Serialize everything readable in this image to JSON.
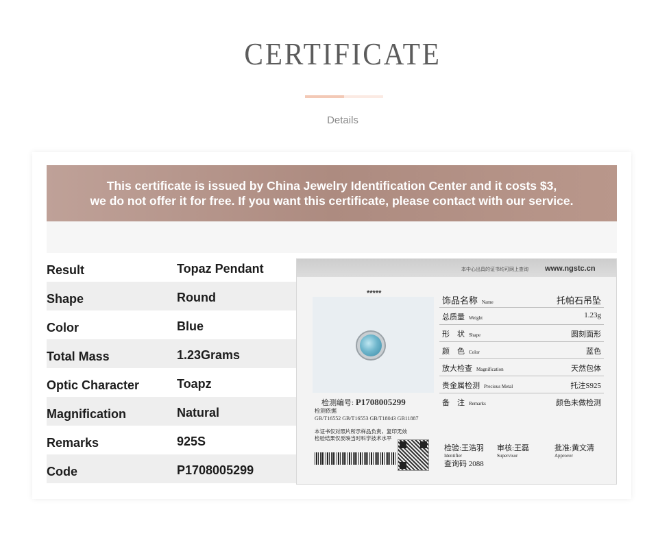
{
  "header": {
    "title": "CERTIFICATE",
    "subtitle": "Details"
  },
  "banner": {
    "line1": "This certificate is issued by China Jewelry Identification Center and it costs $3,",
    "line2": "we do not offer it for free. If you want this certificate, please contact with our service."
  },
  "details": [
    {
      "label": "Result",
      "value": "Topaz Pendant"
    },
    {
      "label": "Shape",
      "value": "Round"
    },
    {
      "label": "Color",
      "value": "Blue"
    },
    {
      "label": "Total Mass",
      "value": "1.23Grams"
    },
    {
      "label": "Optic Character",
      "value": "Toapz"
    },
    {
      "label": "Magnification",
      "value": "Natural"
    },
    {
      "label": "Remarks",
      "value": "925S"
    },
    {
      "label": "Code",
      "value": "P1708005299"
    }
  ],
  "certificate": {
    "top_note": "本中心出具的证书均可网上查询",
    "website": "www.ngstc.cn",
    "stars": "*****",
    "number_label": "检测编号:",
    "number": "P1708005299",
    "basis_label": "检测依据",
    "standards": "GB/T16552 GB/T16553 GB/T18043 GB11887",
    "fine1": "本证书仅对照片所示样品负责，复印无效",
    "fine2": "检验结果仅反映当时科学技术水平",
    "fields": [
      {
        "cn": "饰品名称",
        "en": "Name",
        "value": "托帕石吊坠"
      },
      {
        "cn": "总质量",
        "en": "Weight",
        "value": "1.23g"
      },
      {
        "cn": "形　状",
        "en": "Shape",
        "value": "圆刻面形"
      },
      {
        "cn": "颜　色",
        "en": "Color",
        "value": "蓝色"
      },
      {
        "cn": "放大检查",
        "en": "Magnification",
        "value": "天然包体"
      },
      {
        "cn": "贵金属检测",
        "en": "Precious Metal",
        "value": "托注S925"
      },
      {
        "cn": "备　注",
        "en": "Remarks",
        "value": "颜色未做检测"
      }
    ],
    "identifier_cn": "检验:王浩羽",
    "identifier_en": "Identifier",
    "supervisor_cn": "审核:王磊",
    "supervisor_en": "Supervisor",
    "approver_cn": "批准:黄文清",
    "approver_en": "Approver",
    "check_code": "查询码 2088"
  }
}
